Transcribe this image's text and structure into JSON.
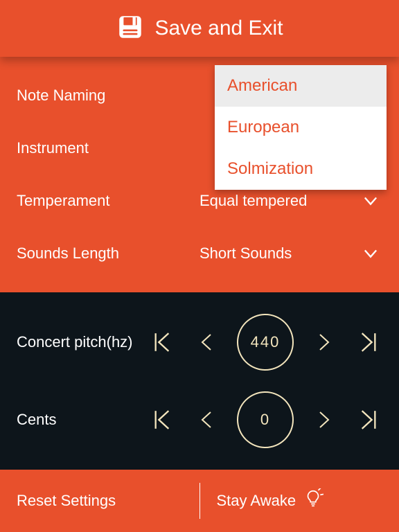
{
  "header": {
    "title": "Save and Exit"
  },
  "settings": {
    "note_naming": {
      "label": "Note Naming",
      "value": "American"
    },
    "instrument": {
      "label": "Instrument",
      "value": ""
    },
    "temperament": {
      "label": "Temperament",
      "value": "Equal tempered"
    },
    "sounds_length": {
      "label": "Sounds Length",
      "value": "Short Sounds"
    }
  },
  "dropdown": {
    "options": [
      "American",
      "European",
      "Solmization"
    ],
    "selected": "American"
  },
  "steppers": {
    "pitch": {
      "label": "Concert pitch(hz)",
      "value": "440"
    },
    "cents": {
      "label": "Cents",
      "value": "0"
    }
  },
  "bottom": {
    "reset": "Reset Settings",
    "stay_awake": "Stay Awake"
  },
  "colors": {
    "accent": "#e8502c",
    "dark": "#0d151b",
    "cream": "#f3e5bd"
  }
}
